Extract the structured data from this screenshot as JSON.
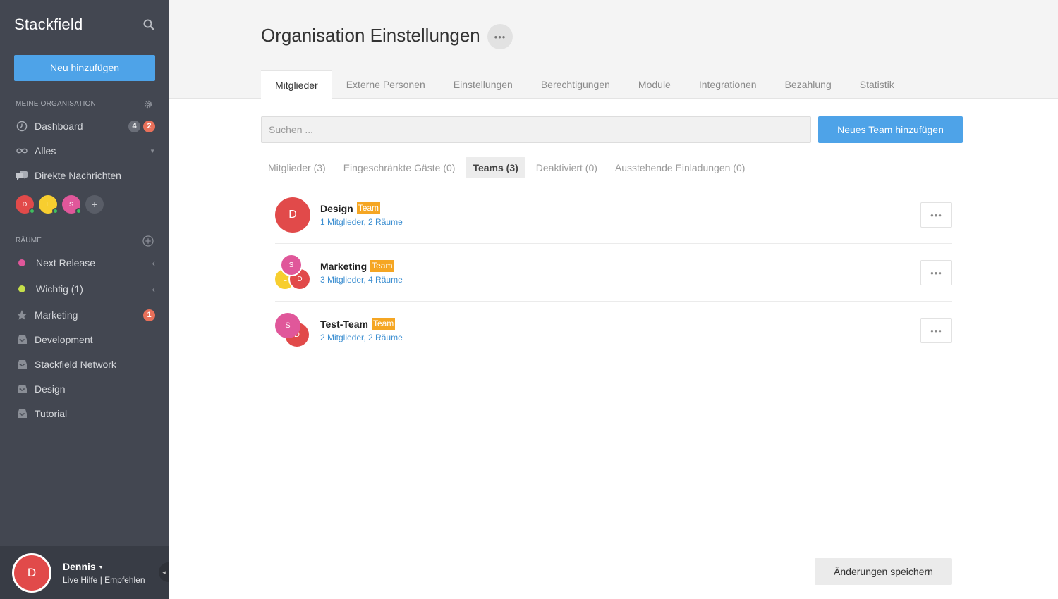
{
  "sidebar": {
    "brand": "Stackfield",
    "new_button": "Neu hinzufügen",
    "org_section": "MEINE ORGANISATION",
    "nav": [
      {
        "label": "Dashboard",
        "icon": "clock-icon",
        "badge_gray": "4",
        "badge_red": "2"
      },
      {
        "label": "Alles",
        "icon": "infinity-icon"
      },
      {
        "label": "Direkte Nachrichten",
        "icon": "chat-bubbles-icon"
      }
    ],
    "dm_avatars": [
      {
        "initial": "D",
        "color": "#e14a4a"
      },
      {
        "initial": "L",
        "color": "#f7ce2f"
      },
      {
        "initial": "S",
        "color": "#e0579a"
      }
    ],
    "dm_add": "+",
    "rooms_section": "RÄUME",
    "rooms": [
      {
        "label": "Next Release",
        "dot_color": "#e0579a"
      },
      {
        "label": "Wichtig (1)",
        "dot_color": "#c6df4a"
      },
      {
        "label": "Marketing",
        "icon": "star-icon",
        "badge_red": "1"
      },
      {
        "label": "Development",
        "icon": "inbox-icon"
      },
      {
        "label": "Stackfield Network",
        "icon": "inbox-icon"
      },
      {
        "label": "Design",
        "icon": "inbox-icon"
      },
      {
        "label": "Tutorial",
        "icon": "inbox-icon"
      }
    ],
    "user": {
      "initial": "D",
      "name": "Dennis",
      "links": "Live Hilfe | Empfehlen"
    }
  },
  "header": {
    "title": "Organisation Einstellungen",
    "more": "•••",
    "tabs": [
      "Mitglieder",
      "Externe Personen",
      "Einstellungen",
      "Berechtigungen",
      "Module",
      "Integrationen",
      "Bezahlung",
      "Statistik"
    ]
  },
  "search": {
    "placeholder": "Suchen ...",
    "value": ""
  },
  "add_team_button": "Neues Team hinzufügen",
  "subtabs": [
    "Mitglieder (3)",
    "Eingeschränkte Gäste (0)",
    "Teams (3)",
    "Deaktiviert (0)",
    "Ausstehende Einladungen (0)"
  ],
  "teams": [
    {
      "name": "Design",
      "tag": "Team",
      "members": "1 Mitglieder",
      "rooms": "2 Räume"
    },
    {
      "name": "Marketing",
      "tag": "Team",
      "members": "3 Mitglieder",
      "rooms": "4 Räume"
    },
    {
      "name": "Test-Team",
      "tag": "Team",
      "members": "2 Mitglieder",
      "rooms": "2 Räume"
    }
  ],
  "row_more": "•••",
  "save_button": "Änderungen speichern",
  "colors": {
    "sidebar_bg": "#434751",
    "accent": "#4ea3e8",
    "tag": "#f5a623",
    "link": "#3d8fd1",
    "avatar_red": "#e14a4a",
    "avatar_yellow": "#f7ce2f",
    "avatar_pink": "#e0579a"
  }
}
